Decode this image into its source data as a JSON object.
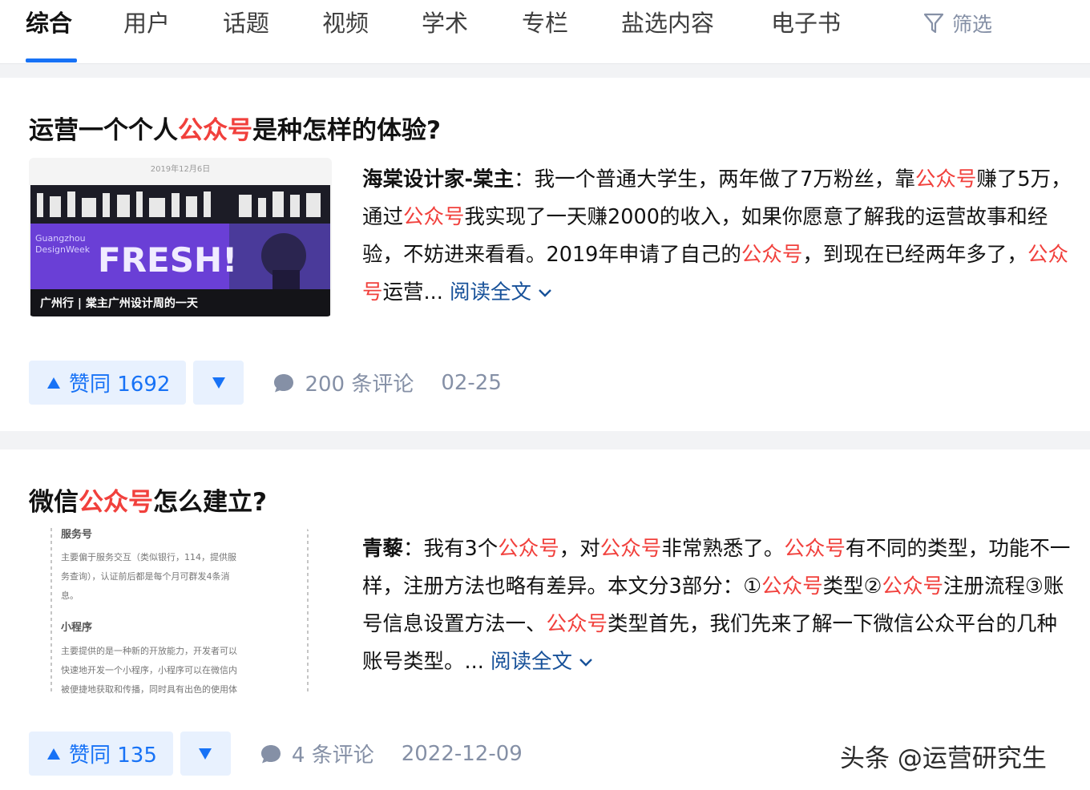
{
  "tabs": [
    {
      "label": "综合",
      "active": true
    },
    {
      "label": "用户"
    },
    {
      "label": "话题"
    },
    {
      "label": "视频"
    },
    {
      "label": "学术"
    },
    {
      "label": "专栏"
    },
    {
      "label": "盐选内容"
    },
    {
      "label": "电子书"
    }
  ],
  "filter_label": "筛选",
  "results": [
    {
      "title_parts": [
        "运营一个个人",
        "公众号",
        "是种怎样的体验?"
      ],
      "thumbnail": {
        "date_text": "2019年12月6日",
        "banner_small_1": "Guangzhou",
        "banner_small_2": "DesignWeek",
        "banner_big": "FRESH!",
        "caption": "广州行 | 棠主广州设计周的一天"
      },
      "author": "海棠设计家-棠主",
      "excerpt_parts": [
        "我一个普通大学生，两年做了7万粉丝，靠",
        "公众号",
        "赚了5万，通过",
        "公众号",
        "我实现了一天赚2000的收入，如果你愿意了解我的运营故事和经验，不妨进来看看。2019年申请了自己的",
        "公众号",
        "，到现在已经两年多了，",
        "公众号",
        "运营..."
      ],
      "read_more": "阅读全文",
      "vote_label": "赞同 1692",
      "comments": "200 条评论",
      "date": "02-25"
    },
    {
      "title_parts": [
        "微信",
        "公众号",
        "怎么建立?"
      ],
      "thumbnail": {
        "heading_1": "服务号",
        "body_1": [
          "主要偏于服务交互（类似银行，114，提供服",
          "务查询），认证前后都是每个月可群发4条消",
          "息。"
        ],
        "heading_2": "小程序",
        "body_2": [
          "主要提供的是一种新的开放能力，开发者可以",
          "快速地开发一个小程序，小程序可以在微信内",
          "被便捷地获取和传播，同时具有出色的使用体"
        ]
      },
      "author": "青藜",
      "excerpt_parts": [
        "我有3个",
        "公众号",
        "，对",
        "公众号",
        "非常熟悉了。",
        "公众号",
        "有不同的类型，功能不一样，注册方法也略有差异。本文分3部分：①",
        "公众号",
        "类型②",
        "公众号",
        "注册流程③账号信息设置方法一、",
        "公众号",
        "类型首先，我们先来了解一下微信公众平台的几种账号类型。..."
      ],
      "read_more": "阅读全文",
      "vote_label": "赞同 135",
      "comments": "4 条评论",
      "date": "2022-12-09"
    }
  ],
  "watermark": "头条 @运营研究生",
  "colors": {
    "accent": "#1772f6",
    "highlight": "#f1403c",
    "link": "#175199",
    "meta": "#8590a6"
  }
}
